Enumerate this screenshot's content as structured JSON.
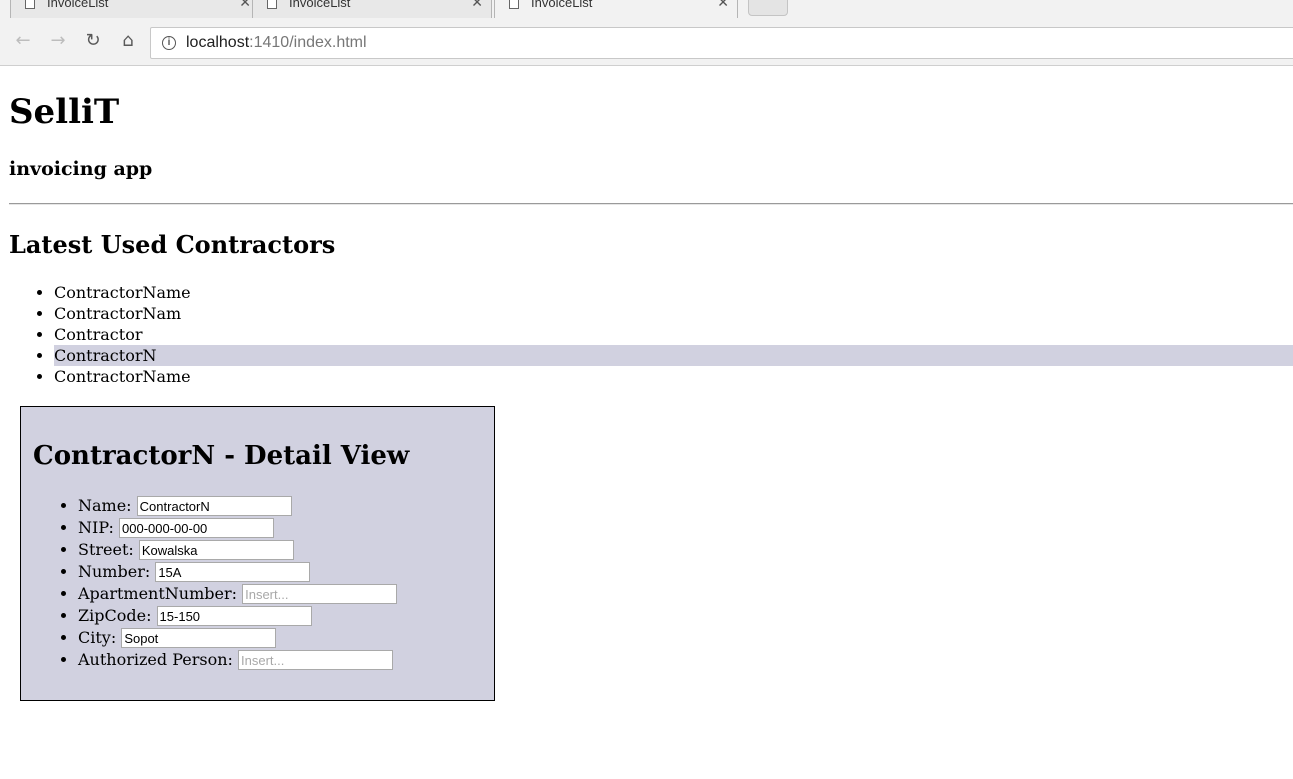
{
  "browser": {
    "tabs": [
      {
        "title": "InvoiceList",
        "active": false
      },
      {
        "title": "InvoiceList",
        "active": false
      },
      {
        "title": "InvoiceList",
        "active": true
      }
    ],
    "url_host": "localhost",
    "url_rest": ":1410/index.html"
  },
  "header": {
    "title": "SelliT",
    "subtitle": "invoicing app"
  },
  "contractors": {
    "heading": "Latest Used Contractors",
    "items": [
      "ContractorName",
      "ContractorNam",
      "Contractor",
      "ContractorN",
      "ContractorName"
    ],
    "selected_index": 3
  },
  "detail": {
    "title": "ContractorN - Detail View",
    "fields": [
      {
        "label": "Name:",
        "value": "ContractorN",
        "placeholder": ""
      },
      {
        "label": "NIP:",
        "value": "000-000-00-00",
        "placeholder": ""
      },
      {
        "label": "Street:",
        "value": "Kowalska",
        "placeholder": ""
      },
      {
        "label": "Number:",
        "value": "15A",
        "placeholder": ""
      },
      {
        "label": "ApartmentNumber:",
        "value": "",
        "placeholder": "Insert..."
      },
      {
        "label": "ZipCode:",
        "value": "15-150",
        "placeholder": ""
      },
      {
        "label": "City:",
        "value": "Sopot",
        "placeholder": ""
      },
      {
        "label": "Authorized Person:",
        "value": "",
        "placeholder": "Insert..."
      }
    ]
  },
  "colors": {
    "highlight": "#d1d1e0",
    "panel": "#d1d1e0"
  }
}
